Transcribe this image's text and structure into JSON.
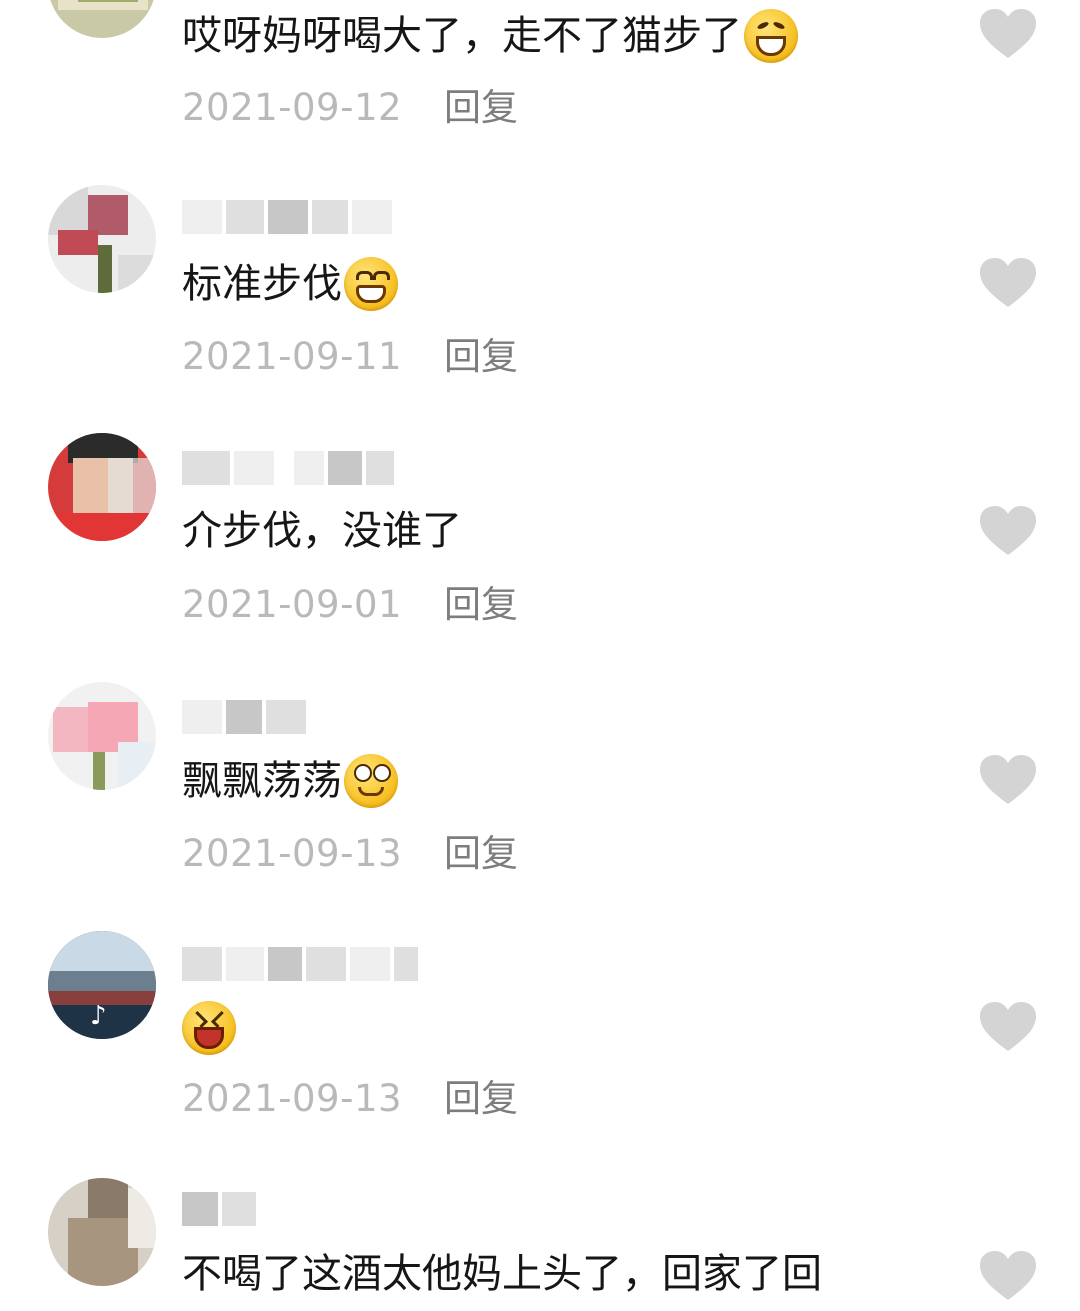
{
  "comments": [
    {
      "text": "哎呀妈呀喝大了，走不了猫步了",
      "emoji": "rolling-laughing-emoji",
      "date": "2021-09-12",
      "reply": "回复"
    },
    {
      "text": "标准步伐",
      "emoji": "grinning-teeth-emoji",
      "date": "2021-09-11",
      "reply": "回复"
    },
    {
      "text": "介步伐，没谁了",
      "emoji": "",
      "date": "2021-09-01",
      "reply": "回复"
    },
    {
      "text": "飘飘荡荡",
      "emoji": "dizzy-smile-emoji",
      "date": "2021-09-13",
      "reply": "回复"
    },
    {
      "text": "",
      "emoji": "laughing-squint-emoji",
      "date": "2021-09-13",
      "reply": "回复"
    },
    {
      "text": "不喝了这酒太他妈上头了，回家了回",
      "emoji": "",
      "date": "",
      "reply": ""
    }
  ],
  "colors": {
    "text": "#161616",
    "date": "#b9b9b9",
    "reply": "#7d7d7d",
    "heart": "#d4d4d4"
  }
}
